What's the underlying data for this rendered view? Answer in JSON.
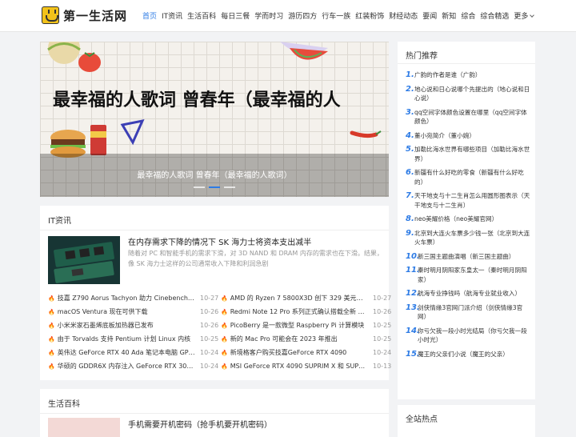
{
  "site": {
    "name": "第一生活网"
  },
  "nav": {
    "items": [
      "首页",
      "IT资讯",
      "生活百科",
      "每日三餐",
      "学而时习",
      "游历四方",
      "行车一族",
      "红装粉饰",
      "财经动态",
      "要闻",
      "新知",
      "综合",
      "综合精选"
    ],
    "more": "更多"
  },
  "hero": {
    "banner_text": "最幸福的人歌词 曾春年（最幸福的人",
    "caption": "最幸福的人歌词 曾春年（最幸福的人歌词）"
  },
  "it": {
    "title": "IT资讯",
    "featured_title": "在内存需求下降的情况下 SK 海力士将资本支出减半",
    "featured_desc": "随着对 PC 和智能手机的需求下滑，对 3D NAND 和 DRAM 内存的需求也在下滑。结果，像 SK 海力士这样的公司通常收入下降和利润急剧",
    "left": [
      {
        "t": "技嘉 Z790 Aorus Tachyon 助力 Cinebench R23 性能",
        "d": "10-27"
      },
      {
        "t": "macOS Ventura 现在可供下载",
        "d": "10-26"
      },
      {
        "t": "小米米家石墨烯底板加热器已发布",
        "d": "10-26"
      },
      {
        "t": "由于 Torvalds 支持 Pentium 计划 Linux 内核",
        "d": "10-25"
      },
      {
        "t": "英伟达 GeForce RTX 40 Ada 笔记本电脑 GPU 规格",
        "d": "10-24"
      },
      {
        "t": "华硕的 GDDR6X 内存注入 GeForce RTX 3060 Ti",
        "d": "10-24"
      }
    ],
    "right": [
      {
        "t": "AMD 的 Ryzen 7 5800X3D 创下 329 美元新低价",
        "d": "10-27"
      },
      {
        "t": "Redmi Note 12 Pro 系列正式确认搭载全新 2 亿像素",
        "d": "10-26"
      },
      {
        "t": "PicoBerry 是一款微型 Raspberry Pi 计算模块",
        "d": "10-25"
      },
      {
        "t": "新的 Mac Pro 可能会在 2023 年推出",
        "d": "10-25"
      },
      {
        "t": "新境格客户购买技嘉GeForce RTX 4090",
        "d": "10-24"
      },
      {
        "t": "MSI GeForce RTX 4090 SUPRIM X 和 SUPRIM Liquid",
        "d": "10-13"
      }
    ]
  },
  "life": {
    "title": "生活百科",
    "featured_title": "手机需要开机密码（抢手机要开机密码）"
  },
  "hot": {
    "title": "热门推荐",
    "items": [
      "广韵的作者是谁（广韵）",
      "地心说和日心说哪个先提出的（地心说和日心说）",
      "qq空间字体颜色设置在哪里（qq空间字体颜色）",
      "董小宛简介（董小婉）",
      "加勒比海水世界有哪些项目（加勒比海水世界）",
      "新疆有什么好吃的零食（新疆有什么好吃的）",
      "天干地支与十二生肖怎么用圆形图表示（天干地支与十二生肖）",
      "neo美耀价格（neo美耀官网）",
      "北京到大连火车票多少钱一张（北京到大连火车票）",
      "新三国主题曲演唱（新三国主题曲）",
      "秦时明月阴阳家东皇太一（秦时明月阴阳家）",
      "航海专业挣钱吗（航海专业就业收入）",
      "剑侠情缘3官网门派介绍（剑侠情缘3官网）",
      "你亏欠我一段小时光结局（你亏欠我一段小时光）",
      "魔王的父亲们小说（魔王的父亲）"
    ]
  },
  "all_hot": {
    "title": "全站热点"
  },
  "colors": {
    "accent": "#2d7be5",
    "fire": "#e5533d"
  }
}
